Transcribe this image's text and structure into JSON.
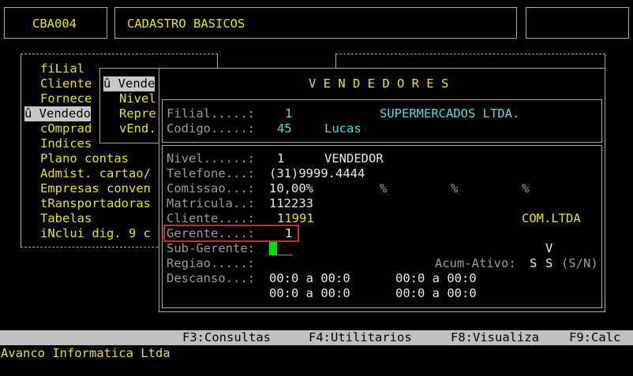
{
  "header": {
    "code": "CBA004",
    "title": "CADASTRO BASICOS"
  },
  "main_menu": [
    {
      "label": "fiLial"
    },
    {
      "label": "Cliente"
    },
    {
      "label": "Fornece"
    },
    {
      "label": "û Vendedo",
      "selected": true
    },
    {
      "label": "cOmprad"
    },
    {
      "label": "Indices"
    },
    {
      "label": "Plano contas"
    },
    {
      "label": "Admist. cartao/"
    },
    {
      "label": "Empresas conven"
    },
    {
      "label": "tRansportadoras"
    },
    {
      "label": "Tabelas"
    },
    {
      "label": "iNclui dig. 9 c"
    }
  ],
  "sub_menu": [
    {
      "label": "û Vende",
      "selected": true
    },
    {
      "label": "Nivel"
    },
    {
      "label": "Repre"
    },
    {
      "label": "vEnd."
    }
  ],
  "dialog": {
    "title": "V E N D E D O R E S",
    "filial_label": "Filial.....:",
    "filial_value": "1",
    "filial_name": "SUPERMERCADOS LTDA.",
    "codigo_label": "Codigo.....:",
    "codigo_value": "45",
    "codigo_name": "Lucas",
    "nivel_label": "Nivel......:",
    "nivel_value": "1",
    "nivel_name": "VENDEDOR",
    "telefone_label": "Telefone...:",
    "telefone_value": "(31)9999.4444",
    "comissao_label": "Comissao...:",
    "comissao_value": "10,00%",
    "pct1": "%",
    "pct2": "%",
    "pct3": "%",
    "matricula_label": "Matricula..:",
    "matricula_value": "112233",
    "cliente_label": "Cliente....:",
    "cliente_value": "11991",
    "cliente_name": "COM.LTDA",
    "gerente_label": "Gerente....:",
    "gerente_value": "1",
    "subgerente_label": "Sub-Gerente:",
    "subgerente_value": "__",
    "v_flag": "V",
    "regiao_label": "Regiao.....:",
    "acum_label": "Acum-Ativo:",
    "acum_v1": "S",
    "acum_v2": "S",
    "acum_hint": "(S/N)",
    "descanso_label": "Descanso...:",
    "descanso_row1a": "00:0 a 00:0",
    "descanso_row1b": "00:0 a 00:0",
    "descanso_row2a": "00:0 a 00:0",
    "descanso_row2b": "00:0 a 00:0"
  },
  "function_bar": {
    "f3": "F3:Consultas",
    "f4": "F4:Utilitarios",
    "f8": "F8:Visualiza",
    "f9": "F9:Calc"
  },
  "footer": {
    "company": "Avanco Informatica Ltda"
  }
}
